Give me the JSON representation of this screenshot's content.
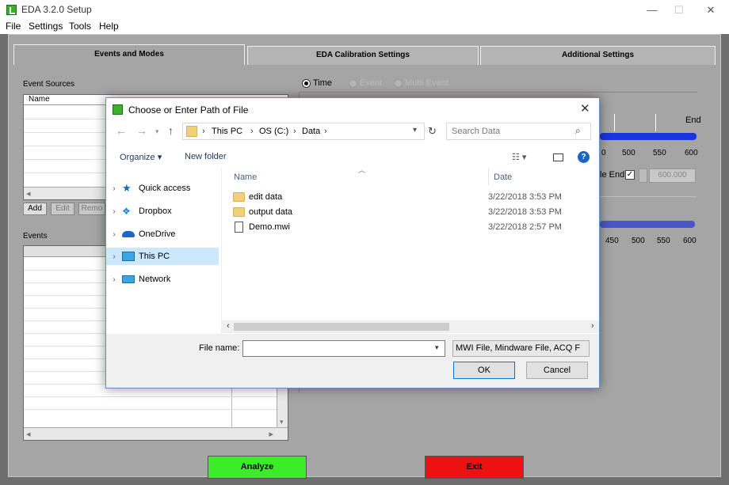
{
  "window": {
    "title": "EDA 3.2.0 Setup",
    "controls": {
      "minimize": "—",
      "maximize": "☐",
      "close": "✕"
    }
  },
  "menu": [
    "File",
    "Settings",
    "Tools",
    "Help"
  ],
  "tabs": [
    "Events and Modes",
    "EDA Calibration Settings",
    "Additional Settings"
  ],
  "event_sources": {
    "label": "Event Sources",
    "column_header": "Name",
    "buttons": {
      "add": "Add",
      "edit": "Edit",
      "remove": "Remo"
    }
  },
  "events": {
    "label": "Events"
  },
  "modes": {
    "time": "Time",
    "event": "Event",
    "multi_event": "Multi-Event",
    "selected": "Time"
  },
  "right_panel": {
    "end_label": "End",
    "ticks_top": [
      "0",
      "500",
      "550",
      "600"
    ],
    "ticks_bottom": [
      "450",
      "500",
      "550",
      "600"
    ],
    "file_end_label": "le End",
    "file_end_checked": true,
    "end_value": "600.000"
  },
  "bottom_buttons": {
    "analyze": "Analyze",
    "exit": "Exit",
    "analyze_color": "#3cec2a",
    "exit_color": "#ee1111"
  },
  "dialog": {
    "title": "Choose or Enter Path of File",
    "breadcrumb": [
      "This PC",
      "OS (C:)",
      "Data"
    ],
    "search_placeholder": "Search Data",
    "toolbar": {
      "organize": "Organize ▾",
      "new_folder": "New folder"
    },
    "nav": [
      "Quick access",
      "Dropbox",
      "OneDrive",
      "This PC",
      "Network"
    ],
    "nav_selected": "This PC",
    "columns": {
      "name": "Name",
      "date": "Date"
    },
    "files": [
      {
        "name": "edit data",
        "date": "3/22/2018 3:53 PM",
        "type": "folder"
      },
      {
        "name": "output data",
        "date": "3/22/2018 3:53 PM",
        "type": "folder"
      },
      {
        "name": "Demo.mwi",
        "date": "3/22/2018 2:57 PM",
        "type": "file"
      }
    ],
    "file_name_label": "File name:",
    "file_name_value": "",
    "file_type": "MWI File, Mindware File, ACQ F",
    "ok": "OK",
    "cancel": "Cancel"
  }
}
